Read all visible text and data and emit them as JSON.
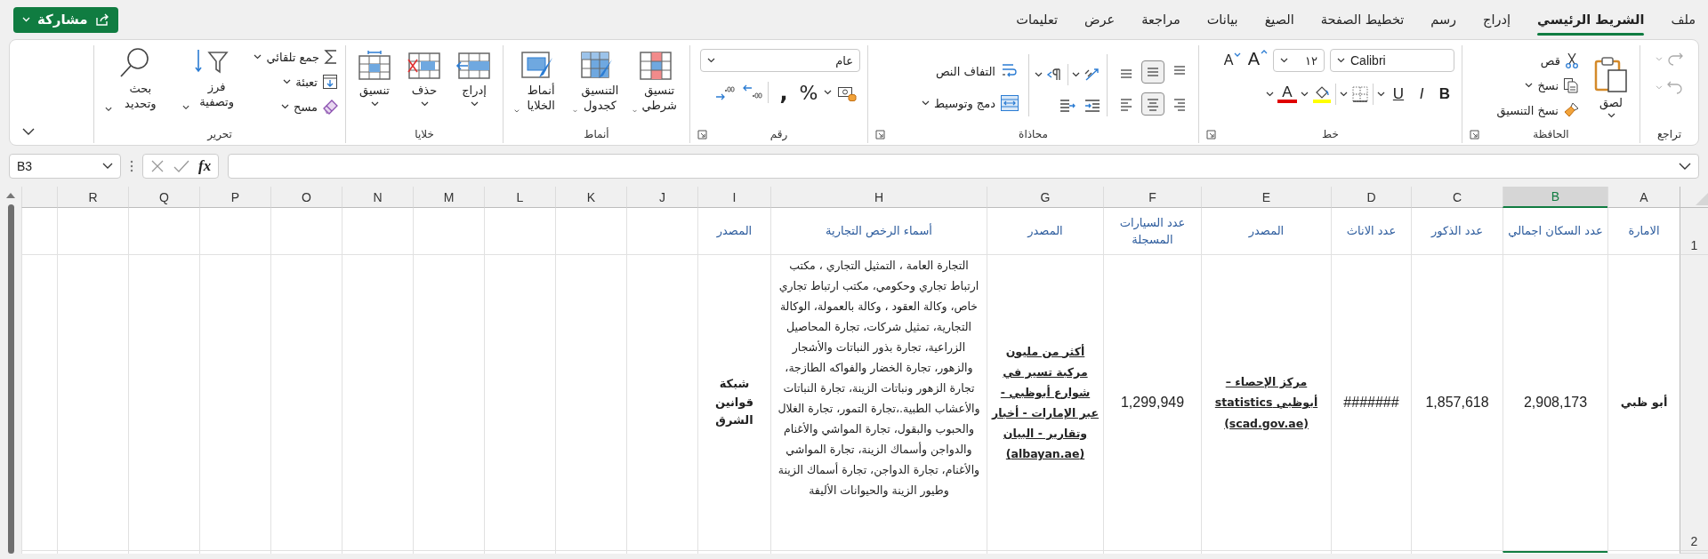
{
  "tabs": [
    {
      "label": "ملف",
      "selected": false
    },
    {
      "label": "الشريط الرئيسي",
      "selected": true
    },
    {
      "label": "إدراج",
      "selected": false
    },
    {
      "label": "رسم",
      "selected": false
    },
    {
      "label": "تخطيط الصفحة",
      "selected": false
    },
    {
      "label": "الصيغ",
      "selected": false
    },
    {
      "label": "بيانات",
      "selected": false
    },
    {
      "label": "مراجعة",
      "selected": false
    },
    {
      "label": "عرض",
      "selected": false
    },
    {
      "label": "تعليمات",
      "selected": false
    }
  ],
  "share_button": {
    "label": "مشاركة"
  },
  "ribbon": {
    "undo": {
      "label": "تراجع",
      "disabled": true
    },
    "clipboard": {
      "label": "الحافظة",
      "paste": "لصق",
      "cut": "قص",
      "copy": "نسخ",
      "format_painter": "نسخ التنسيق"
    },
    "font": {
      "label": "خط",
      "font_name": "Calibri",
      "font_size": "١٢",
      "grow": "A",
      "shrink": "A",
      "bold": "B",
      "italic": "I",
      "underline": "U",
      "font_color": "A"
    },
    "alignment": {
      "label": "محاذاة",
      "wrap_text": "التفاف النص",
      "merge_center": "دمج وتوسيط",
      "buttons": [
        {
          "kind": "top",
          "selected": false
        },
        {
          "kind": "middle",
          "selected": true
        },
        {
          "kind": "bottom",
          "selected": false
        },
        {
          "kind": "right",
          "selected": false
        },
        {
          "kind": "center",
          "selected": true
        },
        {
          "kind": "left",
          "selected": false
        }
      ]
    },
    "number": {
      "label": "رقم",
      "format": "عام",
      "percent": "%",
      "comma": ","
    },
    "styles": {
      "label": "أنماط",
      "conditional": "تنسيق شرطي",
      "format_table": "التنسيق كجدول",
      "cell_styles": "أنماط الخلايا"
    },
    "cells": {
      "label": "خلايا",
      "insert": "إدراج",
      "delete": "حذف",
      "format": "تنسيق"
    },
    "editing": {
      "label": "تحرير",
      "autosum": "جمع تلقائي",
      "fill": "تعبئة",
      "clear": "مسح",
      "sort_filter": "فرز وتصفية",
      "find_select": "بحث وتحديد"
    }
  },
  "formula_bar": {
    "name_box": "B3",
    "function_button": "fx"
  },
  "sheet": {
    "columns": [
      {
        "label": "A",
        "selected": false
      },
      {
        "label": "B",
        "selected": true
      },
      {
        "label": "C",
        "selected": false
      },
      {
        "label": "D",
        "selected": false
      },
      {
        "label": "E",
        "selected": false
      },
      {
        "label": "F",
        "selected": false
      },
      {
        "label": "G",
        "selected": false
      },
      {
        "label": "H",
        "selected": false
      },
      {
        "label": "I",
        "selected": false
      },
      {
        "label": "J",
        "selected": false
      },
      {
        "label": "K",
        "selected": false
      },
      {
        "label": "L",
        "selected": false
      },
      {
        "label": "M",
        "selected": false
      },
      {
        "label": "N",
        "selected": false
      },
      {
        "label": "O",
        "selected": false
      },
      {
        "label": "P",
        "selected": false
      },
      {
        "label": "Q",
        "selected": false
      },
      {
        "label": "R",
        "selected": false
      }
    ],
    "rows": [
      {
        "number": "1",
        "cells": [
          {
            "text": "الامارة",
            "kind": "header"
          },
          {
            "text": "عدد السكان اجمالي",
            "kind": "header"
          },
          {
            "text": "عدد الذكور",
            "kind": "header"
          },
          {
            "text": "عدد الاناث",
            "kind": "header"
          },
          {
            "text": "المصدر",
            "kind": "header"
          },
          {
            "text": "عدد السيارات المسجلة",
            "kind": "header"
          },
          {
            "text": "المصدر",
            "kind": "header"
          },
          {
            "text": "أسماء الرخص التجارية",
            "kind": "header"
          },
          {
            "text": "المصدر",
            "kind": "header"
          }
        ]
      },
      {
        "number": "2",
        "cells": [
          {
            "text": "أبو ظبي",
            "kind": "text"
          },
          {
            "text": "2,908,173",
            "kind": "number"
          },
          {
            "text": "1,857,618",
            "kind": "number"
          },
          {
            "text": "#######",
            "kind": "number"
          },
          {
            "text": "مركز الإحصاء – أبوظبي statistics (scad.gov.ae)",
            "kind": "link"
          },
          {
            "text": "1,299,949",
            "kind": "number"
          },
          {
            "text": "أكثر من مليون مركبة تسير في شوارع أبوظبي - عبر الإمارات - أخبار وتقارير - البيان (albayan.ae)",
            "kind": "link"
          },
          {
            "text": "التجارة العامة ، التمثيل التجاري ، مكتب ارتباط تجاري وحكومي، مكتب ارتباط تجاري خاص، وكالة العقود ، وكالة بالعمولة، الوكالة التجارية، تمثيل شركات، تجارة المحاصيل الزراعية، تجارة بذور النباتات والأشجار والزهور، تجارة الخضار والفواكه الطازجة، تجارة الزهور ونباتات الزينة، تجارة النباتات والأعشاب الطبية.،تجارة التمور، تجارة الغلال والحبوب والبقول، تجارة المواشي والأغنام والدواجن وأسماك الزينة، تجارة المواشي والأغنام، تجارة الدواجن، تجارة أسماك الزينة وطيور الزينة والحيوانات الأليفة",
            "kind": "wrap"
          },
          {
            "text": "شبكة قوانين الشرق",
            "kind": "text"
          }
        ]
      }
    ]
  }
}
